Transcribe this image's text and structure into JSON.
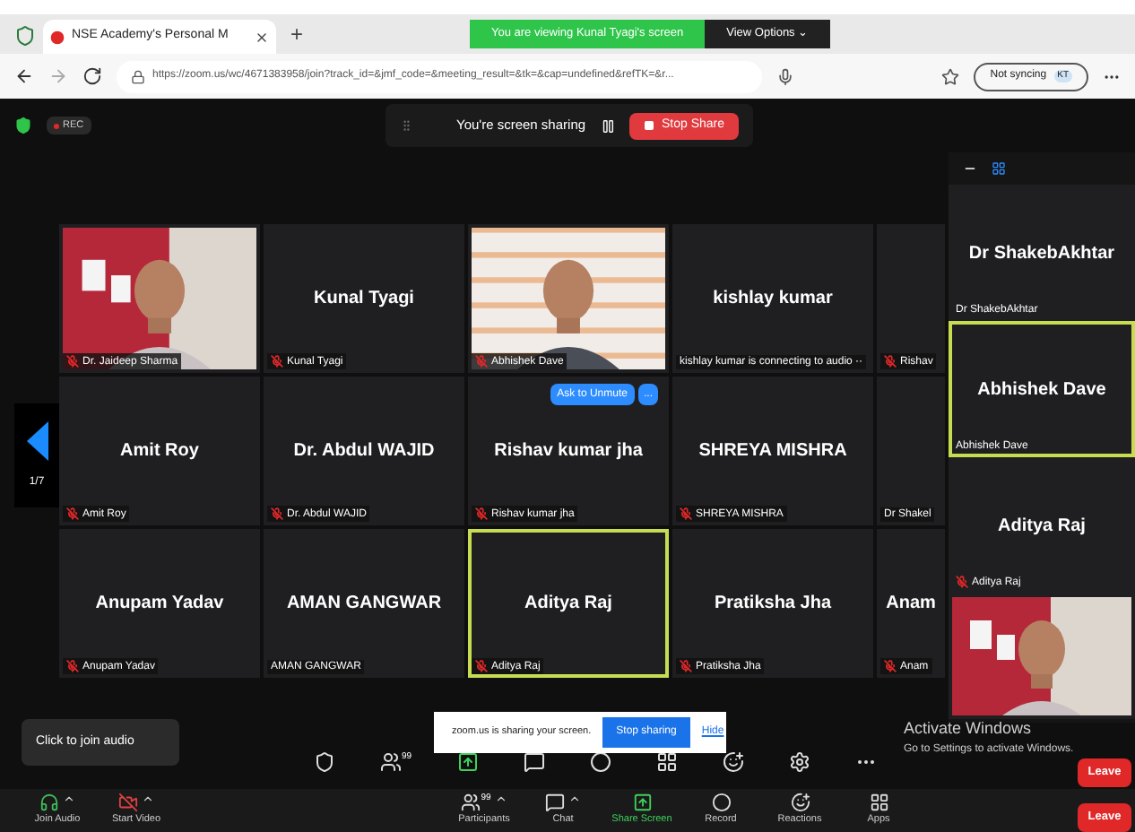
{
  "browser": {
    "tab_title": "NSE Academy's Personal M",
    "new_tab": "+",
    "url": "https://zoom.us/wc/4671383958/join?track_id=&jmf_code=&meeting_result=&tk=&cap=undefined&refTK=&r...",
    "sync": "Not syncing",
    "profile": "KT"
  },
  "banner": {
    "text": "You are viewing Kunal Tyagi's screen",
    "button": "View Options ⌄"
  },
  "meeting": {
    "rec": "REC",
    "share_bar": {
      "text": "You're screen sharing",
      "stop": "Stop Share"
    },
    "pager": "1/7",
    "grid": [
      [
        {
          "kind": "video",
          "label": "Dr. Jaideep Sharma",
          "muted": true,
          "highlighted": false
        },
        {
          "kind": "name",
          "name": "Kunal Tyagi",
          "label": "Kunal Tyagi",
          "muted": true,
          "highlighted": false
        },
        {
          "kind": "backdrop",
          "label": "Abhishek Dave",
          "muted": true,
          "highlighted": false
        },
        {
          "kind": "name",
          "name": "kishlay kumar",
          "label": "kishlay kumar is connecting to audio ··",
          "muted": false,
          "highlighted": false
        },
        {
          "kind": "name",
          "label": "Rishav",
          "muted": true,
          "highlighted": false
        }
      ],
      [
        {
          "kind": "name",
          "name": "Amit Roy",
          "label": "Amit Roy",
          "muted": true,
          "highlighted": false
        },
        {
          "kind": "name",
          "name": "Dr. Abdul WAJID",
          "label": "Dr. Abdul WAJID",
          "muted": true,
          "highlighted": false
        },
        {
          "kind": "name",
          "name": "Rishav kumar jha",
          "label": "Rishav kumar jha",
          "muted": true,
          "highlighted": false,
          "actions": [
            "Ask to Unmute",
            "..."
          ]
        },
        {
          "kind": "name",
          "name": "SHREYA MISHRA",
          "label": "SHREYA MISHRA",
          "muted": true,
          "highlighted": false
        },
        {
          "kind": "name",
          "label": "Dr Shakel",
          "muted": false,
          "highlighted": false
        }
      ],
      [
        {
          "kind": "name",
          "name": "Anupam Yadav",
          "label": "Anupam Yadav",
          "muted": true,
          "highlighted": false
        },
        {
          "kind": "name",
          "name": "AMAN GANGWAR",
          "label": "AMAN GANGWAR",
          "muted": false,
          "highlighted": false
        },
        {
          "kind": "name",
          "name": "Aditya Raj",
          "label": "Aditya Raj",
          "muted": true,
          "highlighted": true
        },
        {
          "kind": "name",
          "name": "Pratiksha Jha",
          "label": "Pratiksha Jha",
          "muted": true,
          "highlighted": false
        },
        {
          "kind": "name",
          "name": "Anam",
          "label": "Anam",
          "muted": true,
          "highlighted": false
        }
      ]
    ],
    "side_panel": [
      {
        "kind": "name",
        "name": "Dr ShakebAkhtar",
        "label": "Dr ShakebAkhtar",
        "muted": false,
        "highlighted": false
      },
      {
        "kind": "name",
        "name": "Abhishek Dave",
        "label": "Abhishek Dave",
        "muted": false,
        "highlighted": true
      },
      {
        "kind": "name",
        "name": "Aditya Raj",
        "label": "Aditya Raj",
        "muted": true,
        "highlighted": false
      },
      {
        "kind": "video",
        "muted": false,
        "highlighted": false
      }
    ],
    "audio_tooltip": "Click to join audio",
    "share_notice": {
      "text": "zoom.us is sharing your screen.",
      "stop": "Stop sharing",
      "hide": "Hide"
    },
    "activation": {
      "title": "Activate Windows",
      "text": "Go to Settings to activate Windows."
    },
    "back_toolbar": [
      {
        "kind": "security"
      },
      {
        "kind": "participants",
        "count": "99"
      },
      {
        "kind": "share"
      },
      {
        "kind": "chat"
      },
      {
        "kind": "record"
      },
      {
        "kind": "breakout"
      },
      {
        "kind": "reactions"
      },
      {
        "kind": "settings"
      },
      {
        "kind": "more"
      }
    ],
    "toolbar": [
      {
        "kind": "audio",
        "label": "Join Audio",
        "caret": true,
        "highlighted": false
      },
      {
        "kind": "video",
        "label": "Start Video",
        "caret": true,
        "highlighted": false
      },
      {
        "kind": "participants",
        "label": "Participants",
        "count": "99",
        "caret": true,
        "highlighted": false
      },
      {
        "kind": "chat",
        "label": "Chat",
        "caret": true,
        "highlighted": false
      },
      {
        "kind": "share",
        "label": "Share Screen",
        "caret": false,
        "highlighted": true
      },
      {
        "kind": "record",
        "label": "Record",
        "caret": false,
        "highlighted": false
      },
      {
        "kind": "reactions",
        "label": "Reactions",
        "caret": false,
        "highlighted": false
      },
      {
        "kind": "apps",
        "label": "Apps",
        "caret": false,
        "highlighted": false
      }
    ],
    "leave": [
      "Leave",
      "Leave"
    ]
  }
}
